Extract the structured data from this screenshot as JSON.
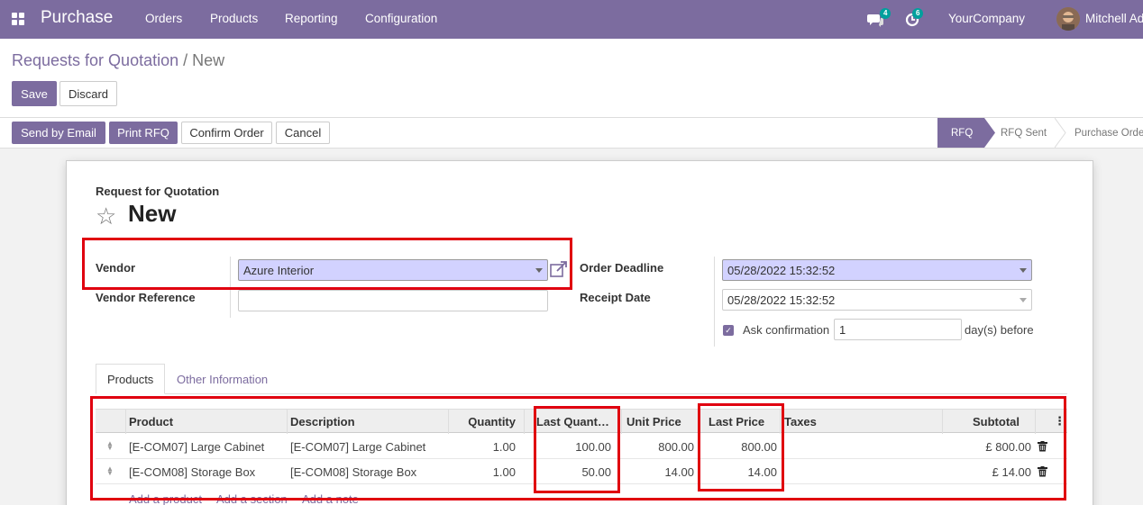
{
  "navbar": {
    "app_name": "Purchase",
    "menu": [
      "Orders",
      "Products",
      "Reporting",
      "Configuration"
    ],
    "messages_count": "4",
    "activities_count": "6",
    "company": "YourCompany",
    "user": "Mitchell Adı"
  },
  "breadcrumb": {
    "parent": "Requests for Quotation",
    "separator": "/",
    "current": "New"
  },
  "actions": {
    "save": "Save",
    "discard": "Discard"
  },
  "status_buttons": {
    "send_email": "Send by Email",
    "print_rfq": "Print RFQ",
    "confirm_order": "Confirm Order",
    "cancel": "Cancel"
  },
  "stages": [
    "RFQ",
    "RFQ Sent",
    "Purchase Orde"
  ],
  "form": {
    "subtitle": "Request for Quotation",
    "name": "New",
    "vendor_label": "Vendor",
    "vendor_value": "Azure Interior",
    "vendor_ref_label": "Vendor Reference",
    "vendor_ref_value": "",
    "order_deadline_label": "Order Deadline",
    "order_deadline_value": "05/28/2022 15:32:52",
    "receipt_date_label": "Receipt Date",
    "receipt_date_value": "05/28/2022 15:32:52",
    "ask_confirmation_label": "Ask confirmation",
    "ask_confirmation_days": "1",
    "days_before_label": "day(s) before"
  },
  "tabs": [
    "Products",
    "Other Information"
  ],
  "table": {
    "headers": {
      "product": "Product",
      "description": "Description",
      "quantity": "Quantity",
      "last_quantity": "Last Quant…",
      "unit_price": "Unit Price",
      "last_price": "Last Price",
      "taxes": "Taxes",
      "subtotal": "Subtotal"
    },
    "rows": [
      {
        "product": "[E-COM07] Large Cabinet",
        "description": "[E-COM07] Large Cabinet",
        "quantity": "1.00",
        "last_quantity": "100.00",
        "unit_price": "800.00",
        "last_price": "800.00",
        "taxes": "",
        "subtotal": "£ 800.00"
      },
      {
        "product": "[E-COM08] Storage Box",
        "description": "[E-COM08] Storage Box",
        "quantity": "1.00",
        "last_quantity": "50.00",
        "unit_price": "14.00",
        "last_price": "14.00",
        "taxes": "",
        "subtotal": "£ 14.00"
      }
    ],
    "add_links": [
      "Add a product",
      "Add a section",
      "Add a note"
    ]
  },
  "colors": {
    "brand": "#7c6c9f",
    "highlight": "#e0000f",
    "required_field": "#d2d2ff"
  }
}
